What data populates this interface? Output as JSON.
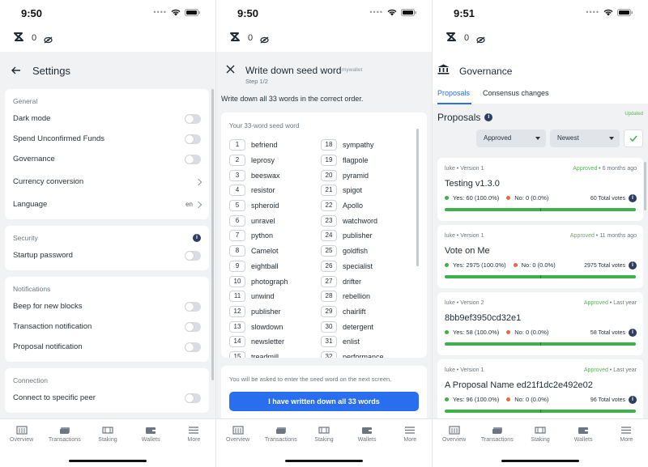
{
  "screens": {
    "settings": {
      "status_time": "9:50",
      "balance": "0",
      "title": "Settings",
      "sections": [
        {
          "name": "General",
          "rows": [
            {
              "label": "Dark mode",
              "control": "toggle"
            },
            {
              "label": "Spend Unconfirmed Funds",
              "control": "toggle"
            },
            {
              "label": "Governance",
              "control": "toggle"
            },
            {
              "label": "Currency conversion",
              "control": "chevron"
            },
            {
              "label": "Language",
              "control": "chevron",
              "value": "en"
            }
          ]
        },
        {
          "name": "Security",
          "rows": [
            {
              "label": "Startup password",
              "control": "toggle"
            }
          ]
        },
        {
          "name": "Notifications",
          "rows": [
            {
              "label": "Beep for new blocks",
              "control": "toggle"
            },
            {
              "label": "Transaction notification",
              "control": "toggle"
            },
            {
              "label": "Proposal notification",
              "control": "toggle"
            }
          ]
        },
        {
          "name": "Connection",
          "rows": [
            {
              "label": "Connect to specific peer",
              "control": "toggle"
            }
          ]
        }
      ]
    },
    "seed": {
      "status_time": "9:50",
      "balance": "0",
      "title": "Write down seed word",
      "badge": "mywallet",
      "step": "Step 1/2",
      "instruction": "Write down all 33 words in the correct order.",
      "card_caption": "Your 33-word seed word",
      "words_left": [
        {
          "n": "1",
          "w": "befriend"
        },
        {
          "n": "2",
          "w": "leprosy"
        },
        {
          "n": "3",
          "w": "beeswax"
        },
        {
          "n": "4",
          "w": "resistor"
        },
        {
          "n": "5",
          "w": "spheroid"
        },
        {
          "n": "6",
          "w": "unravel"
        },
        {
          "n": "7",
          "w": "python"
        },
        {
          "n": "8",
          "w": "Camelot"
        },
        {
          "n": "9",
          "w": "eightball"
        },
        {
          "n": "10",
          "w": "photograph"
        },
        {
          "n": "11",
          "w": "unwind"
        },
        {
          "n": "12",
          "w": "publisher"
        },
        {
          "n": "13",
          "w": "slowdown"
        },
        {
          "n": "14",
          "w": "newsletter"
        },
        {
          "n": "15",
          "w": "treadmill"
        }
      ],
      "words_right": [
        {
          "n": "18",
          "w": "sympathy"
        },
        {
          "n": "19",
          "w": "flagpole"
        },
        {
          "n": "20",
          "w": "pyramid"
        },
        {
          "n": "21",
          "w": "spigot"
        },
        {
          "n": "22",
          "w": "Apollo"
        },
        {
          "n": "23",
          "w": "watchword"
        },
        {
          "n": "24",
          "w": "publisher"
        },
        {
          "n": "25",
          "w": "goldfish"
        },
        {
          "n": "26",
          "w": "specialist"
        },
        {
          "n": "27",
          "w": "drifter"
        },
        {
          "n": "28",
          "w": "rebellion"
        },
        {
          "n": "29",
          "w": "chairlift"
        },
        {
          "n": "30",
          "w": "detergent"
        },
        {
          "n": "31",
          "w": "enlist"
        },
        {
          "n": "32",
          "w": "performance"
        }
      ],
      "note": "You will be asked to enter the seed word on the next screen.",
      "button_label": "I have written down all 33 words"
    },
    "governance": {
      "status_time": "9:51",
      "balance": "0",
      "title": "Governance",
      "tabs": [
        "Proposals",
        "Consensus changes"
      ],
      "updated": "Updated",
      "proposals_title": "Proposals",
      "filter_status": "Approved",
      "filter_sort": "Newest",
      "proposals": [
        {
          "author": "luke",
          "version": "Version 1",
          "status": "Approved",
          "age": "6 months ago",
          "name": "Testing v1.3.0",
          "yes": "Yes: 60 (100.0%)",
          "no": "No: 0 (0.0%)",
          "total": "60 Total votes",
          "yes_fraction": 1.0
        },
        {
          "author": "luke",
          "version": "Version 1",
          "status": "Approved",
          "age": "11 months ago",
          "name": "Vote on Me",
          "yes": "Yes: 2975 (100.0%)",
          "no": "No: 0 (0.0%)",
          "total": "2975 Total votes",
          "yes_fraction": 1.0
        },
        {
          "author": "luke",
          "version": "Version 2",
          "status": "Approved",
          "age": "Last year",
          "name": "8bb9ef3950cd32e1",
          "yes": "Yes: 58 (100.0%)",
          "no": "No: 0 (0.0%)",
          "total": "58 Total votes",
          "yes_fraction": 1.0
        },
        {
          "author": "luke",
          "version": "Version 1",
          "status": "Approved",
          "age": "Last year",
          "name": "A Proposal Name ed21f1dc2e492e02",
          "yes": "Yes: 96 (100.0%)",
          "no": "No: 0 (0.0%)",
          "total": "96 Total votes",
          "yes_fraction": 1.0
        }
      ]
    }
  },
  "tabbar": [
    "Overview",
    "Transactions",
    "Staking",
    "Wallets",
    "More"
  ],
  "colors": {
    "accent": "#2a6ef0",
    "approved": "#5fb35d",
    "yes": "#3cb14c",
    "no": "#e9693d"
  }
}
